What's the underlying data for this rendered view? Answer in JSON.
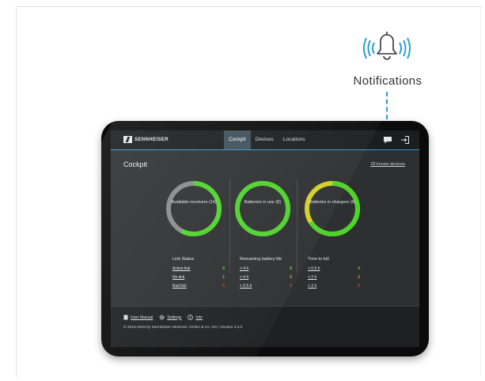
{
  "callout": {
    "label": "Notifications"
  },
  "app": {
    "logo_text": "SENNHEISER",
    "tabs": [
      {
        "label": "Cockpit",
        "active": true
      },
      {
        "label": "Devices",
        "active": false
      },
      {
        "label": "Locations",
        "active": false
      }
    ]
  },
  "main": {
    "title": "Cockpit",
    "known_devices": "28 known devices",
    "rings": [
      {
        "label": "Available receivers (14)",
        "fraction": 0.58,
        "colors": {
          "fill": "#4dd32a",
          "rest": "#8a8a8a"
        }
      },
      {
        "label": "Batteries in use (8)",
        "fraction": 1.0,
        "colors": {
          "fill": "#4dd32a",
          "rest": "#8a8a8a"
        }
      },
      {
        "label": "Batteries in chargers (6)",
        "fraction": 0.66,
        "colors": {
          "fill": "#4dd32a",
          "rest": "#d4d024"
        }
      }
    ],
    "columns": [
      {
        "heading": "Link Status",
        "rows": [
          {
            "label": "Active link",
            "value": "8",
            "color": "#4dd32a"
          },
          {
            "label": "No link",
            "value": "1",
            "color": "#e0a022"
          },
          {
            "label": "Bad link",
            "value": "5",
            "color": "#e03a22"
          }
        ]
      },
      {
        "heading": "Remaining battery life",
        "rows": [
          {
            "label": "> 4 h",
            "value": "8",
            "color": "#4dd32a"
          },
          {
            "label": "< 4 h",
            "value": "0",
            "color": "#e0a022"
          },
          {
            "label": "< 0.5 h",
            "value": "0",
            "color": "#e03a22"
          }
        ]
      },
      {
        "heading": "Time to full",
        "rows": [
          {
            "label": "< 0.5 h",
            "value": "4",
            "color": "#4dd32a"
          },
          {
            "label": "< 2 h",
            "value": "2",
            "color": "#e0a022"
          },
          {
            "label": "> 2 h",
            "value": "0",
            "color": "#e03a22"
          }
        ]
      }
    ]
  },
  "footer": {
    "user_manual": "User Manual",
    "settings": "Settings",
    "info": "Info",
    "copyright": "© 2016-2019 by Sennheiser electronic GmbH & Co. KG | Version 3.3.0"
  },
  "icons": [
    "bell-icon",
    "chat-icon",
    "logout-icon",
    "sennheiser-logo-icon",
    "book-icon",
    "gear-icon",
    "info-icon"
  ],
  "colors": {
    "accent": "#2a9fd6",
    "ok": "#4dd32a",
    "warn": "#e0a022",
    "bad": "#e03a22"
  }
}
